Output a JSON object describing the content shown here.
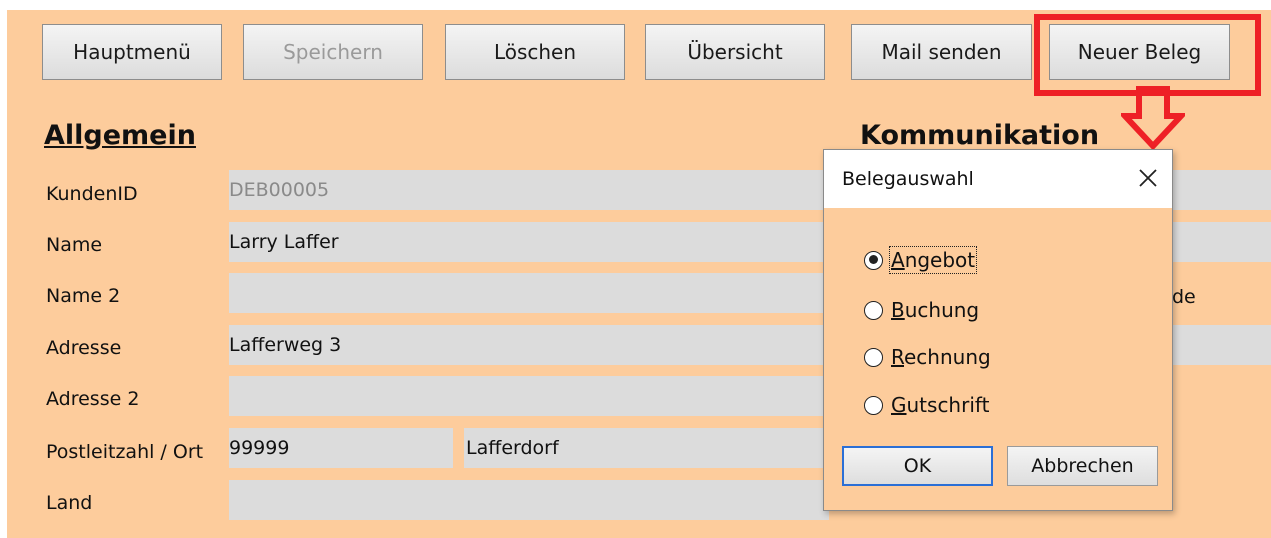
{
  "toolbar": {
    "buttons": [
      {
        "label": "Hauptmenü",
        "enabled": true
      },
      {
        "label": "Speichern",
        "enabled": false
      },
      {
        "label": "Löschen",
        "enabled": true
      },
      {
        "label": "Übersicht",
        "enabled": true
      },
      {
        "label": "Mail senden",
        "enabled": true
      },
      {
        "label": "Neuer Beleg",
        "enabled": true,
        "highlighted": true
      }
    ]
  },
  "sections": {
    "general": "Allgemein",
    "communication": "Kommunikation"
  },
  "fields": {
    "kunden_id": {
      "label": "KundenID",
      "value": "DEB00005"
    },
    "name": {
      "label": "Name",
      "value": "Larry Laffer"
    },
    "name2": {
      "label": "Name 2",
      "value": ""
    },
    "adresse": {
      "label": "Adresse",
      "value": "Lafferweg 3"
    },
    "adresse2": {
      "label": "Adresse 2",
      "value": ""
    },
    "plz_ort": {
      "label": "Postleitzahl / Ort",
      "plz": "99999",
      "ort": "Lafferdorf"
    },
    "land": {
      "label": "Land",
      "value": ""
    }
  },
  "communication_partial_text": "de",
  "dialog": {
    "title": "Belegauswahl",
    "options": [
      {
        "label": "Angebot",
        "selected": true
      },
      {
        "label": "Buchung",
        "selected": false
      },
      {
        "label": "Rechnung",
        "selected": false
      },
      {
        "label": "Gutschrift",
        "selected": false
      }
    ],
    "ok_label": "OK",
    "cancel_label": "Abbrechen"
  },
  "colors": {
    "form_background": "#fdcc9c",
    "field_background": "#dcdcdc",
    "annotation_red": "#ee2026",
    "focus_blue": "#2b6fd6"
  },
  "icons": {
    "close": "close-icon",
    "annotation_arrow": "down-arrow-icon"
  }
}
